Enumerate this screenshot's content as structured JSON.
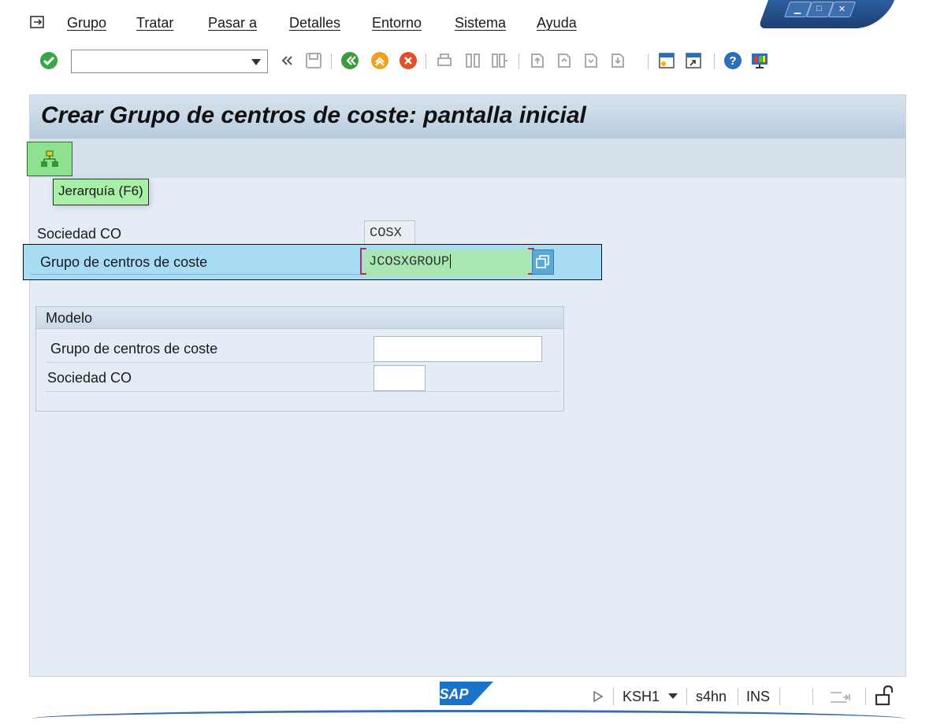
{
  "menu": {
    "items": [
      "Grupo",
      "Tratar",
      "Pasar a",
      "Detalles",
      "Entorno",
      "Sistema",
      "Ayuda"
    ]
  },
  "toolbar": {
    "command_value": "",
    "icons": [
      "enter-icon",
      "back-double-icon",
      "save-icon",
      "back-icon",
      "exit-icon",
      "cancel-icon",
      "print-icon",
      "find-icon",
      "find-next-icon",
      "first-page-icon",
      "prev-page-icon",
      "next-page-icon",
      "last-page-icon",
      "create-session-icon",
      "shortcut-icon",
      "help-icon",
      "customize-layout-icon"
    ]
  },
  "screen": {
    "title": "Crear Grupo de centros de coste: pantalla inicial",
    "tooltip": "Jerarquía   (F6)"
  },
  "form": {
    "sociedad_label": "Sociedad CO",
    "sociedad_value": "COSX",
    "grupo_label": "Grupo de centros de coste",
    "grupo_value": "JCOSXGROUP"
  },
  "modelo": {
    "title": "Modelo",
    "grupo_label": "Grupo de centros de coste",
    "grupo_value": "",
    "sociedad_label": "Sociedad CO",
    "sociedad_value": ""
  },
  "status": {
    "transaction": "KSH1",
    "system": "s4hn",
    "mode": "INS"
  },
  "colors": {
    "focus": "#a8dcf5",
    "highlight": "#8fe08f",
    "content_bg": "#e4edf5",
    "sap_blue": "#1a73c7"
  }
}
